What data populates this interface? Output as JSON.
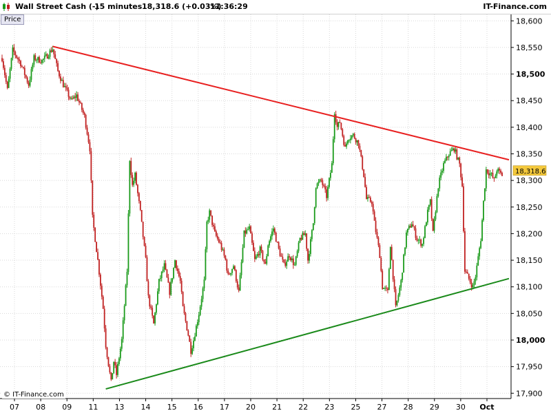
{
  "header": {
    "instrument": "Wall Street Cash (-)",
    "interval": "15 minutes",
    "price_change": "18,318.6 (+0.03%)",
    "time": "11:36:29",
    "brand": "IT-Finance.com",
    "panel_label": "Price",
    "copyright": "© IT-Finance.com"
  },
  "colors": {
    "up_candle": "#1a9a1a",
    "down_candle": "#c02020",
    "resistance_line": "#e82020",
    "support_line": "#1a8a1a",
    "last_price_tag": "#f3c83c",
    "grid": "#d8d8d8"
  },
  "chart_data": {
    "type": "candlestick",
    "ylim": [
      17890,
      18612
    ],
    "y_ticks": [
      "18,600",
      "18,550",
      "18,500",
      "18,450",
      "18,400",
      "18,350",
      "18,300",
      "18,250",
      "18,200",
      "18,150",
      "18,100",
      "18,050",
      "18,000",
      "17,950",
      "17,900"
    ],
    "y_tick_values": [
      18600,
      18550,
      18500,
      18450,
      18400,
      18350,
      18300,
      18250,
      18200,
      18150,
      18100,
      18050,
      18000,
      17950,
      17900
    ],
    "bold_tick_values": [
      18500,
      18000
    ],
    "x_ticks": [
      "07",
      "08",
      "09",
      "11",
      "13",
      "14",
      "15",
      "16",
      "17",
      "20",
      "21",
      "22",
      "23",
      "25",
      "27",
      "28",
      "29",
      "30",
      "Oct"
    ],
    "last_price": 18318.6,
    "last_price_label": "18,318.6",
    "path": [
      [
        0,
        18530
      ],
      [
        2,
        18470
      ],
      [
        4,
        18545
      ],
      [
        7,
        18520
      ],
      [
        10,
        18480
      ],
      [
        12,
        18530
      ],
      [
        15,
        18525
      ],
      [
        17,
        18535
      ],
      [
        19,
        18548
      ],
      [
        21,
        18505
      ],
      [
        23,
        18480
      ],
      [
        26,
        18450
      ],
      [
        28,
        18460
      ],
      [
        31,
        18420
      ],
      [
        33,
        18360
      ],
      [
        34,
        18230
      ],
      [
        36,
        18150
      ],
      [
        38,
        18060
      ],
      [
        39,
        17990
      ],
      [
        41,
        17920
      ],
      [
        42,
        17960
      ],
      [
        43,
        17935
      ],
      [
        45,
        18000
      ],
      [
        47,
        18130
      ],
      [
        48,
        18340
      ],
      [
        49,
        18290
      ],
      [
        50,
        18310
      ],
      [
        52,
        18240
      ],
      [
        54,
        18150
      ],
      [
        55,
        18080
      ],
      [
        57,
        18030
      ],
      [
        59,
        18110
      ],
      [
        61,
        18140
      ],
      [
        63,
        18090
      ],
      [
        65,
        18150
      ],
      [
        67,
        18110
      ],
      [
        68,
        18060
      ],
      [
        70,
        18010
      ],
      [
        71,
        17980
      ],
      [
        72,
        18000
      ],
      [
        74,
        18050
      ],
      [
        76,
        18110
      ],
      [
        77,
        18220
      ],
      [
        78,
        18240
      ],
      [
        80,
        18200
      ],
      [
        82,
        18180
      ],
      [
        84,
        18150
      ],
      [
        85,
        18120
      ],
      [
        87,
        18140
      ],
      [
        89,
        18090
      ],
      [
        91,
        18200
      ],
      [
        93,
        18210
      ],
      [
        95,
        18150
      ],
      [
        97,
        18170
      ],
      [
        99,
        18140
      ],
      [
        100,
        18180
      ],
      [
        102,
        18210
      ],
      [
        104,
        18170
      ],
      [
        106,
        18140
      ],
      [
        108,
        18160
      ],
      [
        110,
        18140
      ],
      [
        112,
        18190
      ],
      [
        114,
        18200
      ],
      [
        115,
        18150
      ],
      [
        117,
        18220
      ],
      [
        118,
        18290
      ],
      [
        120,
        18300
      ],
      [
        122,
        18270
      ],
      [
        124,
        18330
      ],
      [
        125,
        18430
      ],
      [
        126,
        18400
      ],
      [
        127,
        18410
      ],
      [
        129,
        18360
      ],
      [
        130,
        18380
      ],
      [
        132,
        18385
      ],
      [
        134,
        18370
      ],
      [
        136,
        18310
      ],
      [
        137,
        18265
      ],
      [
        139,
        18260
      ],
      [
        140,
        18220
      ],
      [
        142,
        18160
      ],
      [
        143,
        18100
      ],
      [
        145,
        18090
      ],
      [
        146,
        18180
      ],
      [
        147,
        18120
      ],
      [
        148,
        18060
      ],
      [
        150,
        18110
      ],
      [
        152,
        18200
      ],
      [
        154,
        18220
      ],
      [
        156,
        18190
      ],
      [
        158,
        18180
      ],
      [
        160,
        18240
      ],
      [
        161,
        18260
      ],
      [
        162,
        18200
      ],
      [
        164,
        18290
      ],
      [
        166,
        18330
      ],
      [
        168,
        18350
      ],
      [
        170,
        18360
      ],
      [
        172,
        18330
      ],
      [
        173,
        18290
      ],
      [
        174,
        18130
      ],
      [
        176,
        18110
      ],
      [
        177,
        18100
      ],
      [
        178,
        18120
      ],
      [
        180,
        18190
      ],
      [
        181,
        18260
      ],
      [
        182,
        18320
      ],
      [
        184,
        18310
      ],
      [
        185,
        18300
      ],
      [
        186,
        18320
      ],
      [
        188,
        18310
      ]
    ],
    "path_x_domain": [
      0,
      188
    ],
    "annotations": [
      {
        "name": "resistance-trendline",
        "from": [
          19,
          18552
        ],
        "to": [
          188,
          18342
        ]
      },
      {
        "name": "support-trendline",
        "from": [
          39,
          17908
        ],
        "to": [
          188,
          18112
        ]
      }
    ]
  }
}
